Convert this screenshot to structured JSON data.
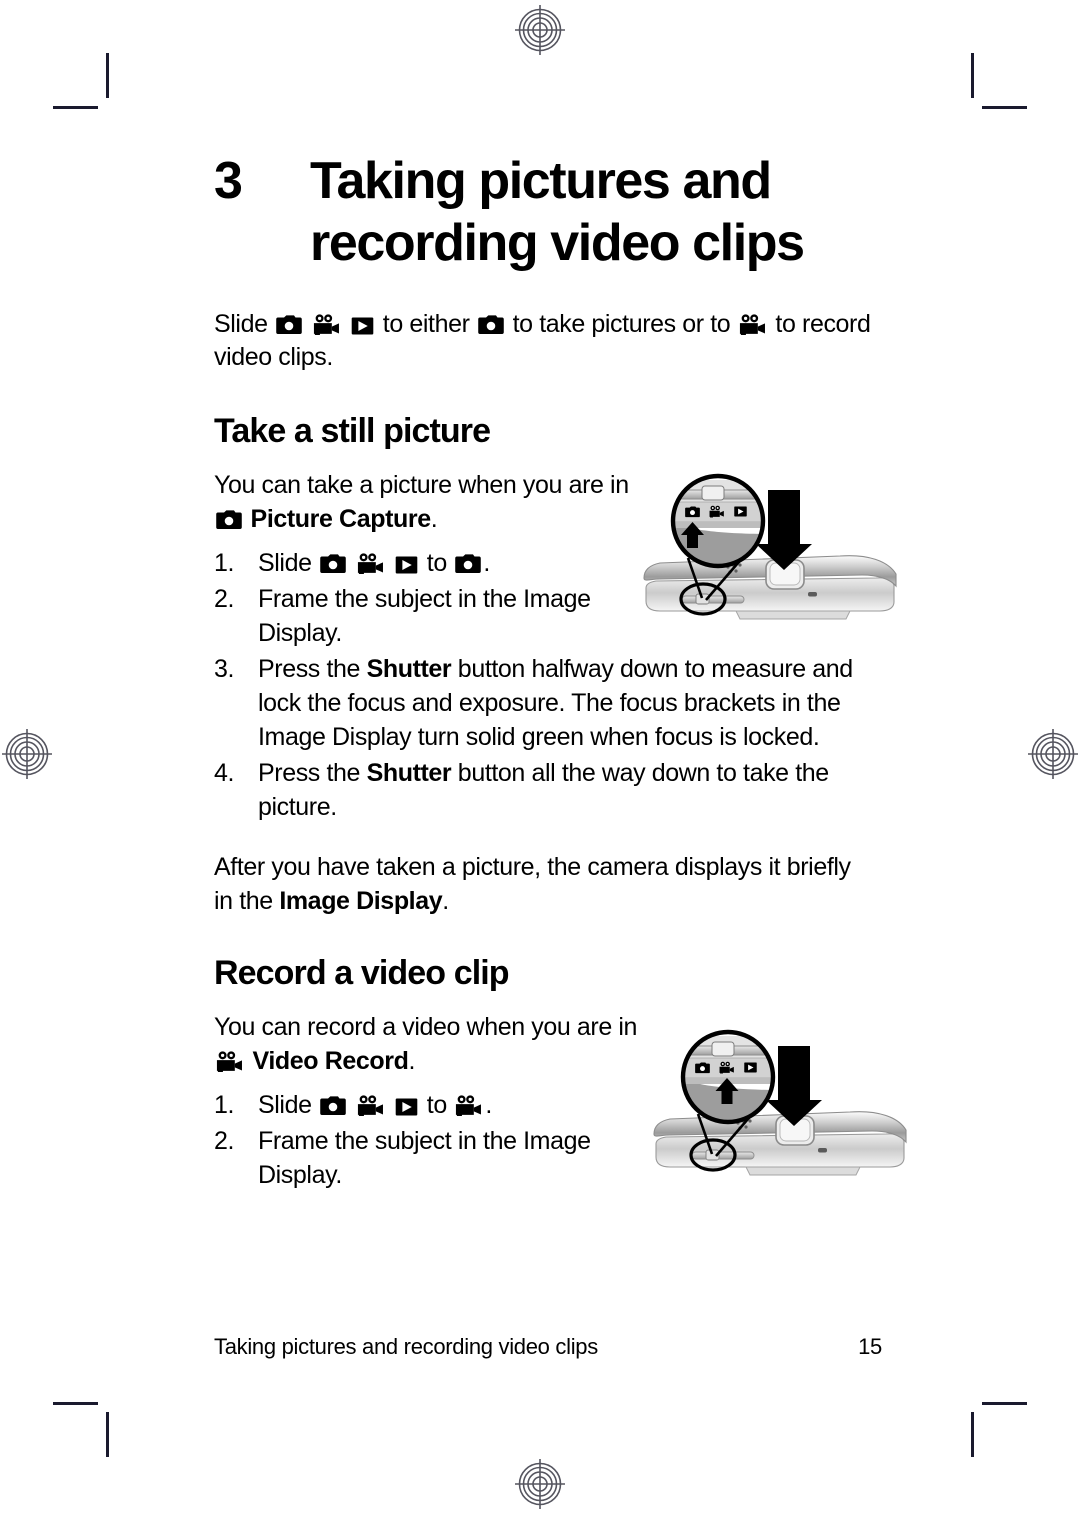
{
  "document": {
    "type": "camera-user-manual-page",
    "page_number": "15"
  },
  "chapter": {
    "number": "3",
    "title_line1": "Taking pictures and",
    "title_line2": "recording video clips"
  },
  "intro": {
    "part1": "Slide",
    "icons1": [
      "camera-icon",
      "video-camera-icon",
      "playback-icon"
    ],
    "part2": "to either",
    "icon2": "camera-icon",
    "part3": "to take pictures or to",
    "icon3": "video-camera-icon",
    "part4": "to",
    "part5": "record video clips."
  },
  "sections": [
    {
      "heading": "Take a still picture",
      "intro_part1": "You can take a picture when you are in",
      "intro_icon": "camera-icon",
      "intro_bold": "Picture Capture",
      "intro_end": ".",
      "steps": [
        {
          "num": "1.",
          "pre": "Slide",
          "icons": [
            "camera-icon",
            "video-camera-icon",
            "playback-icon"
          ],
          "mid": "to",
          "target_icon": "camera-icon",
          "post": "."
        },
        {
          "num": "2.",
          "text": "Frame the subject in the Image Display."
        },
        {
          "num": "3.",
          "text_pre": "Press the ",
          "text_bold": "Shutter",
          "text_post": " button halfway down to measure and lock the focus and exposure. The focus brackets in the Image Display turn solid green when focus is locked."
        },
        {
          "num": "4.",
          "text_pre": "Press the ",
          "text_bold": "Shutter",
          "text_post": " button all the way down to take the picture."
        }
      ],
      "after_pre": "After you have taken a picture, the camera displays it briefly in the ",
      "after_bold": "Image Display",
      "after_post": "."
    },
    {
      "heading": "Record a video clip",
      "intro_part1": "You can record a video when you are in",
      "intro_icon": "video-camera-icon",
      "intro_bold": "Video Record",
      "intro_end": ".",
      "steps": [
        {
          "num": "1.",
          "pre": "Slide",
          "icons": [
            "camera-icon",
            "video-camera-icon",
            "playback-icon"
          ],
          "mid": "to",
          "target_icon": "video-camera-icon",
          "post": "."
        },
        {
          "num": "2.",
          "text": "Frame the subject in the Image Display."
        }
      ]
    }
  ],
  "figures": [
    {
      "name": "camera-top-view-picture-capture",
      "callout": "mode-switch-magnifier",
      "highlighted_mode": "camera-icon",
      "arrow_up": "mode-slider-arrow",
      "arrow_down": "shutter-button-arrow"
    },
    {
      "name": "camera-top-view-video-record",
      "callout": "mode-switch-magnifier",
      "highlighted_mode": "video-camera-icon",
      "arrow_up": "mode-slider-arrow",
      "arrow_down": "shutter-button-arrow"
    }
  ],
  "footer": {
    "running_title": "Taking pictures and recording video clips",
    "page_number": "15"
  },
  "print_marks": {
    "registration_marks": [
      "top-center",
      "left-middle",
      "right-middle",
      "bottom-center"
    ],
    "crop_marks": [
      "top-left",
      "top-right",
      "bottom-left",
      "bottom-right"
    ]
  },
  "colors": {
    "text": "#000000",
    "crop_mark": "#1a1a2e",
    "registration_mark": "#55555f",
    "camera_body_light": "#f2f2f2",
    "camera_body_mid": "#b9b9b9",
    "camera_body_dark": "#7d7d7d"
  }
}
